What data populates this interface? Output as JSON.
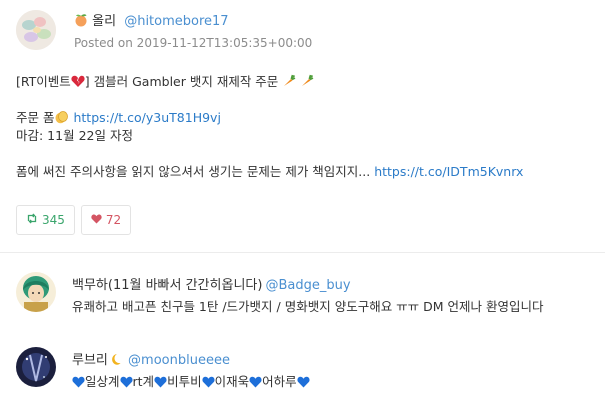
{
  "main_tweet": {
    "display_name": "올리",
    "handle": "@hitomebore17",
    "posted": "Posted on 2019-11-12T13:05:35+00:00",
    "line1_prefix": "[RT이벤트",
    "line1_middle": "] 갬블러 Gambler 뱃지 재제작 주문",
    "line2_text": "주문 폼",
    "line2_link": "https://t.co/y3uT81H9vj",
    "line3_text": "마감: 11월 22일 자정",
    "line4_text": "폼에 써진 주의사항을 읽지 않으셔서 생기는 문제는 제가 책임지지...",
    "line4_link": "https://t.co/IDTm5Kvnrx",
    "retweets": "345",
    "likes": "72"
  },
  "users": [
    {
      "display_name": "백무하(11월 바빠서 간간히옵니다)",
      "handle": "@Badge_buy",
      "bio": "유쾌하고 배고픈 친구들 1탄 /드가뱃지 / 명화뱃지 양도구해요 ㅠㅠ DM 언제나 환영입니다"
    },
    {
      "display_name": "루브리",
      "handle": "@moonblueeee",
      "bio_parts": [
        "일상계",
        "rt계",
        "비투비",
        "이재욱",
        "어하루"
      ]
    }
  ],
  "colors": {
    "link": "#2b7bc8",
    "handle": "#4a8fd0",
    "retweet": "#3aa56c",
    "like": "#d45563",
    "blue_heart": "#1e6fd9"
  },
  "icons": {
    "retweet": "retweet-icon",
    "like": "heart-icon",
    "peach": "peach-icon",
    "broken_heart": "broken-heart-icon",
    "carrot": "carrot-icon",
    "clapping": "clapping-hands-icon",
    "moon": "crescent-moon-icon",
    "blue_heart": "blue-heart-icon"
  }
}
